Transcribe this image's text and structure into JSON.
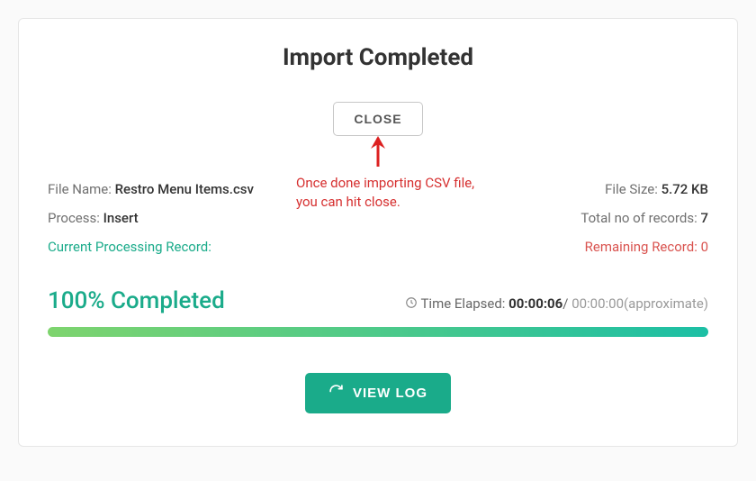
{
  "title": "Import Completed",
  "close_label": "CLOSE",
  "annotation": {
    "line1": "Once done importing CSV file,",
    "line2": "you can hit close."
  },
  "info": {
    "file_name_label": "File Name: ",
    "file_name": "Restro Menu Items.csv",
    "file_size_label": "File Size: ",
    "file_size": "5.72 KB",
    "process_label": "Process: ",
    "process": "Insert",
    "total_records_label": "Total no of records: ",
    "total_records": "7",
    "current_processing_label": "Current Processing Record:",
    "remaining_label": "Remaining Record: ",
    "remaining": "0"
  },
  "progress": {
    "percent_text": "100% Completed",
    "time_label": "Time Elapsed: ",
    "time_elapsed": "00:00:06",
    "separator": "/ ",
    "time_approx": "00:00:00(approximate)"
  },
  "viewlog_label": "VIEW LOG"
}
